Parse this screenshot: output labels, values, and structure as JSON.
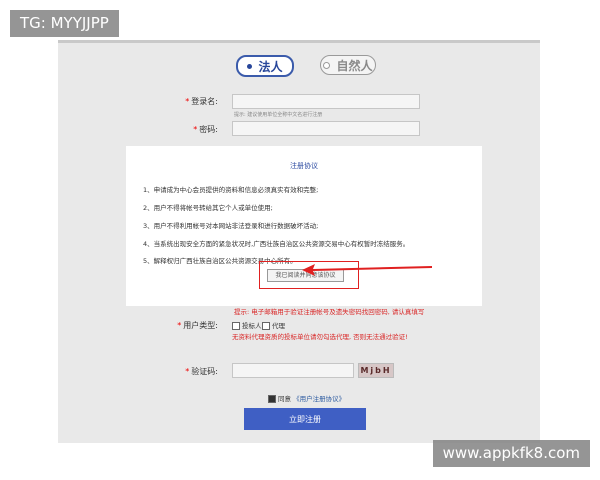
{
  "watermarks": {
    "top_left": "TG: MYYJJPP",
    "bottom_right": "www.appkfk8.com"
  },
  "user_types": {
    "selected": "法人",
    "other": "自然人"
  },
  "form": {
    "login_label": "登录名:",
    "login_hint": "提示: 建议使用单位全称中文名进行注册",
    "password_label": "密码:",
    "email_hint": "提示: 电子邮箱用于验证注册帐号及遗失密码找回密码, 请认真填写",
    "user_type_label": "用户类型:",
    "option_tenderer": "投标人",
    "option_agent": "代理",
    "agent_warning": "无资料代理资质的投标单位请勿勾选代理, 否则无法通过验证!",
    "captcha_label": "验证码:",
    "captcha_text": "MjbH",
    "agree_text": "同意",
    "agreement_link": "《用户注册协议》",
    "submit_label": "立即注册"
  },
  "modal": {
    "title": "注册协议",
    "items": [
      "1、申请成为中心会员提供的资料和信息必须真实有效和完整;",
      "2、用户不得将帐号转给其它个人或单位使用;",
      "3、用户不得利用帐号对本网站非法登录和进行数据破坏活动;",
      "4、当系统出现安全方面的紧急状况时,广西壮族自治区公共资源交易中心有权暂时冻结服务。",
      "5、解释权归广西壮族自治区公共资源交易中心所有。"
    ],
    "agree_button": "我已阅读并同意该协议"
  },
  "colors": {
    "brand_blue": "#3f5fc4",
    "highlight_red": "#e02020"
  }
}
